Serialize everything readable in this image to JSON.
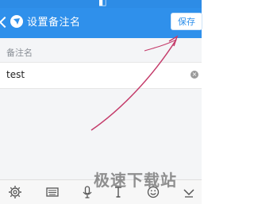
{
  "header": {
    "title": "设置备注名",
    "save_label": "保存",
    "logo_icon": "app-logo-icon",
    "back_icon": "chevron-left-icon"
  },
  "form": {
    "section_label": "备注名",
    "input_value": "test",
    "clear_icon": "clear-circle-icon"
  },
  "toolbar": {
    "icons": [
      "gear-icon",
      "keyboard-icon",
      "microphone-icon",
      "text-cursor-icon",
      "emoji-icon",
      "collapse-icon"
    ]
  },
  "watermark": {
    "text": "极速下载站"
  },
  "colors": {
    "accent": "#2f90eb",
    "annotation_arrow": "#c43b6a"
  }
}
